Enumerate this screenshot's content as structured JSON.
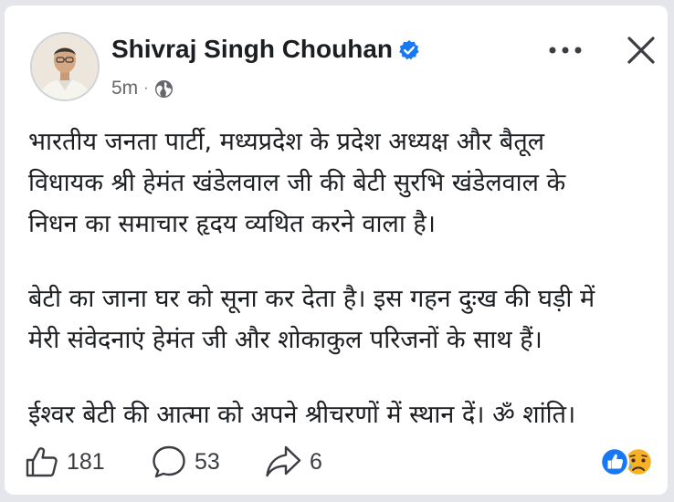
{
  "post": {
    "author": "Shivraj Singh Chouhan",
    "time": "5m",
    "separator": "·",
    "lines": [
      "भारतीय जनता पार्टी, मध्यप्रदेश के प्रदेश अध्यक्ष और बैतूल",
      "विधायक श्री हेमंत खंडेलवाल जी की बेटी सुरभि खंडेलवाल के",
      "निधन का समाचार हृदय व्यथित करने वाला है।",
      "बेटी का जाना घर को सूना कर देता है। इस गहन दुःख की घड़ी में",
      "मेरी संवेदनाएं हेमंत जी और शोकाकुल परिजनों के साथ हैं।",
      "ईश्वर बेटी की आत्मा को अपने श्रीचरणों में स्थान दें। ॐ शांति।"
    ]
  },
  "stats": {
    "likes": "181",
    "comments": "53",
    "shares": "6"
  },
  "icons": {
    "verified": "verified-badge-icon",
    "privacy": "globe-icon",
    "more": "more-options-icon",
    "close": "close-icon",
    "like": "thumbs-up-icon",
    "comment": "comment-bubble-icon",
    "share": "share-arrow-icon",
    "reactions": [
      "like-reaction-icon",
      "sad-reaction-icon"
    ]
  },
  "colors": {
    "brand_blue": "#1877f2",
    "text": "#1c1e21",
    "secondary": "#65676b"
  }
}
